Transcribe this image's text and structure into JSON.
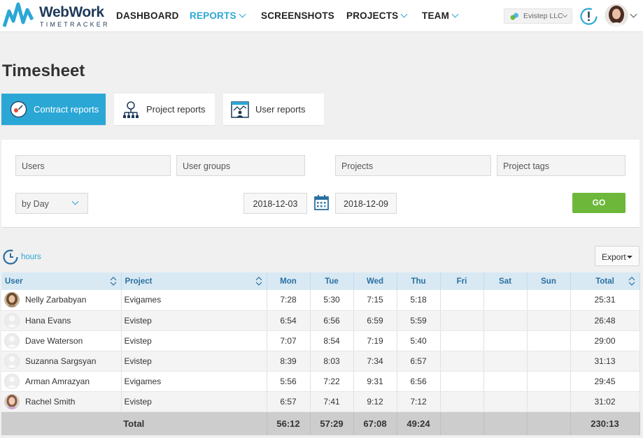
{
  "brand": {
    "name": "WebWork",
    "sub": "TIMETRACKER",
    "color": "#1f3a5a",
    "accent": "#2ba7d6"
  },
  "nav": {
    "dashboard": "DASHBOARD",
    "reports": "REPORTS",
    "screenshots": "SCREENSHOTS",
    "projects": "PROJECTS",
    "team": "TEAM"
  },
  "header": {
    "company": "Evistep LLC"
  },
  "page": {
    "title": "Timesheet"
  },
  "tabs": {
    "contract": "Contract reports",
    "project": "Project reports",
    "user": "User reports"
  },
  "filters": {
    "users": "Users",
    "user_groups": "User groups",
    "projects": "Projects",
    "project_tags": "Project tags",
    "group_by": "by  Day",
    "date_from": "2018-12-03",
    "date_to": "2018-12-09",
    "go": "GO"
  },
  "toolbar": {
    "hours": "hours",
    "export": "Export"
  },
  "table": {
    "headers": {
      "user": "User",
      "project": "Project",
      "mon": "Mon",
      "tue": "Tue",
      "wed": "Wed",
      "thu": "Thu",
      "fri": "Fri",
      "sat": "Sat",
      "sun": "Sun",
      "total": "Total"
    },
    "rows": [
      {
        "user": "Nelly  Zarbabyan",
        "project": "Evigames",
        "mon": "7:28",
        "tue": "5:30",
        "wed": "7:15",
        "thu": "5:18",
        "fri": "",
        "sat": "",
        "sun": "",
        "total": "25:31"
      },
      {
        "user": "Hana  Evans",
        "project": "Evistep",
        "mon": "6:54",
        "tue": "6:56",
        "wed": "6:59",
        "thu": "5:59",
        "fri": "",
        "sat": "",
        "sun": "",
        "total": "26:48"
      },
      {
        "user": "Dave  Waterson",
        "project": "Evistep",
        "mon": "7:07",
        "tue": "8:54",
        "wed": "7:19",
        "thu": "5:40",
        "fri": "",
        "sat": "",
        "sun": "",
        "total": "29:00"
      },
      {
        "user": "Suzanna  Sargsyan",
        "project": "Evistep",
        "mon": "8:39",
        "tue": "8:03",
        "wed": "7:34",
        "thu": "6:57",
        "fri": "",
        "sat": "",
        "sun": "",
        "total": "31:13"
      },
      {
        "user": "Arman  Amrazyan",
        "project": "Evigames",
        "mon": "5:56",
        "tue": "7:22",
        "wed": "9:31",
        "thu": "6:56",
        "fri": "",
        "sat": "",
        "sun": "",
        "total": "29:45"
      },
      {
        "user": "Rachel  Smith",
        "project": "Evistep",
        "mon": "6:57",
        "tue": "7:41",
        "wed": "9:12",
        "thu": "7:12",
        "fri": "",
        "sat": "",
        "sun": "",
        "total": "31:02"
      }
    ],
    "totals": {
      "label": "Total",
      "mon": "56:12",
      "tue": "57:29",
      "wed": "67:08",
      "thu": "49:24",
      "fri": "",
      "sat": "",
      "sun": "",
      "total": "230:13"
    }
  },
  "colors": {
    "go": "#6db83a",
    "header_row": "#d8e9f4",
    "total_row": "#cdcdcd"
  }
}
